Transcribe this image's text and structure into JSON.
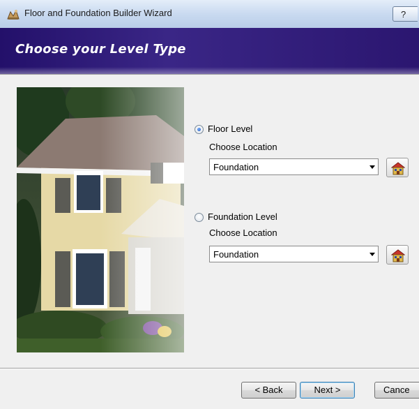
{
  "window": {
    "title": "Floor and Foundation Builder Wizard",
    "help_label": "?"
  },
  "banner": {
    "title": "Choose your Level Type"
  },
  "options": [
    {
      "label": "Floor Level",
      "sub_label": "Choose Location",
      "selected": true,
      "combo_value": "Foundation"
    },
    {
      "label": "Foundation Level",
      "sub_label": "Choose Location",
      "selected": false,
      "combo_value": "Foundation"
    }
  ],
  "buttons": {
    "back": "< Back",
    "next": "Next >",
    "cancel": "Cance"
  },
  "icons": {
    "pick_location": "house-floor-icon",
    "app": "builder-wizard-icon"
  },
  "colors": {
    "banner": "#2b1670",
    "banner_text": "#ffffff"
  }
}
